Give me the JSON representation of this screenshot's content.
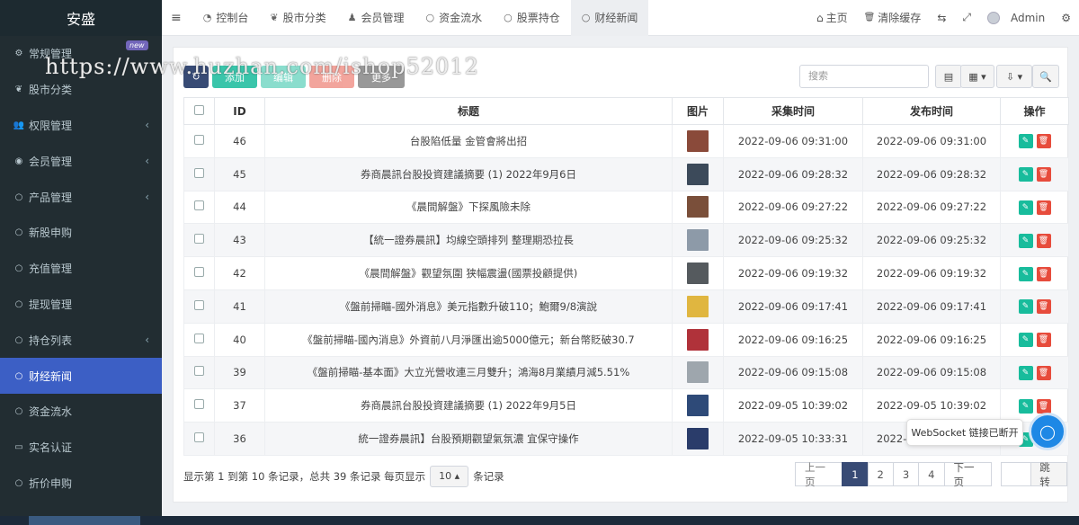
{
  "sidebar": {
    "logo": "安盛",
    "items": [
      {
        "label": "常规管理",
        "icon": "cogs-icon",
        "glyph": "⚙",
        "badge": "new",
        "chevron": ""
      },
      {
        "label": "股市分类",
        "icon": "leaf-icon",
        "glyph": "❦",
        "chevron": ""
      },
      {
        "label": "权限管理",
        "icon": "group-icon",
        "glyph": "👥",
        "chevron": "‹"
      },
      {
        "label": "会员管理",
        "icon": "user-circle-icon",
        "glyph": "◉",
        "chevron": "‹"
      },
      {
        "label": "产品管理",
        "icon": "circle-icon",
        "glyph": "○",
        "chevron": "‹"
      },
      {
        "label": "新股申购",
        "icon": "circle-icon",
        "glyph": "○",
        "chevron": ""
      },
      {
        "label": "充值管理",
        "icon": "circle-icon",
        "glyph": "○",
        "chevron": ""
      },
      {
        "label": "提现管理",
        "icon": "circle-icon",
        "glyph": "○",
        "chevron": ""
      },
      {
        "label": "持仓列表",
        "icon": "circle-icon",
        "glyph": "○",
        "chevron": "‹"
      },
      {
        "label": "财经新闻",
        "icon": "circle-icon",
        "glyph": "○",
        "chevron": "",
        "active": true
      },
      {
        "label": "资金流水",
        "icon": "circle-icon",
        "glyph": "○",
        "chevron": ""
      },
      {
        "label": "实名认证",
        "icon": "id-card-icon",
        "glyph": "▭",
        "chevron": ""
      },
      {
        "label": "折价申购",
        "icon": "circle-icon",
        "glyph": "○",
        "chevron": ""
      }
    ]
  },
  "topbar": {
    "menu_glyph": "≡",
    "tabs": [
      {
        "label": "控制台",
        "icon": "dashboard-icon",
        "glyph": "◔"
      },
      {
        "label": "股市分类",
        "icon": "leaf-icon",
        "glyph": "❦"
      },
      {
        "label": "会员管理",
        "icon": "user-icon",
        "glyph": "♟"
      },
      {
        "label": "资金流水",
        "icon": "circle-icon",
        "glyph": "○"
      },
      {
        "label": "股票持仓",
        "icon": "circle-icon",
        "glyph": "○"
      },
      {
        "label": "财经新闻",
        "icon": "circle-icon",
        "glyph": "○",
        "active": true
      }
    ],
    "right": {
      "home_label": "主页",
      "home_glyph": "⌂",
      "clear_label": "清除缓存",
      "clear_glyph": "🗑",
      "translate_glyph": "⇆",
      "fullscreen_glyph": "⤢",
      "admin_label": "Admin",
      "settings_glyph": "⚙"
    }
  },
  "watermark": "https://www.huzhan.com/ishop52012",
  "toolbar": {
    "refresh_glyph": "↻",
    "add_label": "添加",
    "edit_label": "编辑",
    "delete_label": "删除",
    "more_label": "更多",
    "search_placeholder": "搜索",
    "toggle_glyph": "▤",
    "columns_glyph": "▦ ▾",
    "export_glyph": "⇩ ▾",
    "search_glyph": "🔍"
  },
  "table": {
    "headers": [
      "",
      "ID",
      "标题",
      "图片",
      "采集时间",
      "发布时间",
      "操作"
    ],
    "rows": [
      {
        "id": "46",
        "title": "台股陷低量 金管會將出招",
        "thumb_color": "#8a4a3a",
        "collected": "2022-09-06 09:31:00",
        "published": "2022-09-06 09:31:00"
      },
      {
        "id": "45",
        "title": "券商晨訊台股投資建議摘要 (1) 2022年9月6日",
        "thumb_color": "#3c4a5a",
        "collected": "2022-09-06 09:28:32",
        "published": "2022-09-06 09:28:32"
      },
      {
        "id": "44",
        "title": "《晨間解盤》下探風險未除",
        "thumb_color": "#7a4f3a",
        "collected": "2022-09-06 09:27:22",
        "published": "2022-09-06 09:27:22"
      },
      {
        "id": "43",
        "title": "【統一證券晨訊】均線空頭排列 整理期恐拉長",
        "thumb_color": "#8d9aa8",
        "collected": "2022-09-06 09:25:32",
        "published": "2022-09-06 09:25:32"
      },
      {
        "id": "42",
        "title": "《晨間解盤》觀望氛圍 狭幅震盪(國票投顧提供)",
        "thumb_color": "#555a5e",
        "collected": "2022-09-06 09:19:32",
        "published": "2022-09-06 09:19:32"
      },
      {
        "id": "41",
        "title": "《盤前掃瞄-國外消息》美元指數升破110；鮑爾9/8演說",
        "thumb_color": "#e0b640",
        "collected": "2022-09-06 09:17:41",
        "published": "2022-09-06 09:17:41"
      },
      {
        "id": "40",
        "title": "《盤前掃瞄-國內消息》外資前八月淨匯出逾5000億元；新台幣貶破30.7",
        "thumb_color": "#b0323a",
        "collected": "2022-09-06 09:16:25",
        "published": "2022-09-06 09:16:25"
      },
      {
        "id": "39",
        "title": "《盤前掃瞄-基本面》大立光營收連三月雙升；鴻海8月業績月減5.51%",
        "thumb_color": "#9ea6ad",
        "collected": "2022-09-06 09:15:08",
        "published": "2022-09-06 09:15:08"
      },
      {
        "id": "37",
        "title": "券商晨訊台股投資建議摘要 (1) 2022年9月5日",
        "thumb_color": "#2e4a78",
        "collected": "2022-09-05 10:39:02",
        "published": "2022-09-05 10:39:02"
      },
      {
        "id": "36",
        "title": "統一證券晨訊】台股預期觀望氣氛濃 宜保守操作",
        "thumb_color": "#2a3c6a",
        "collected": "2022-09-05 10:33:31",
        "published": "2022-09-05 10:33:31"
      }
    ],
    "edit_glyph": "✎",
    "delete_glyph": "🗑"
  },
  "footer": {
    "info_label": "显示第 1 到第 10 条记录，总共 39 条记录 每页显示",
    "page_size": "10 ▴",
    "suffix_label": "条记录",
    "prev_label": "上一页",
    "pages": [
      "1",
      "2",
      "3",
      "4"
    ],
    "current_page": "1",
    "next_label": "下一页",
    "jump_label": "跳转"
  },
  "websocket": {
    "status_label": "WebSocket 链接已断开",
    "icon_glyph": "◯"
  },
  "colors": {
    "sidebar_bg": "#222d32",
    "active_item": "#3c5fc5",
    "success": "#18bc9c",
    "danger": "#e74c3c",
    "primary_dark": "#384b75"
  }
}
